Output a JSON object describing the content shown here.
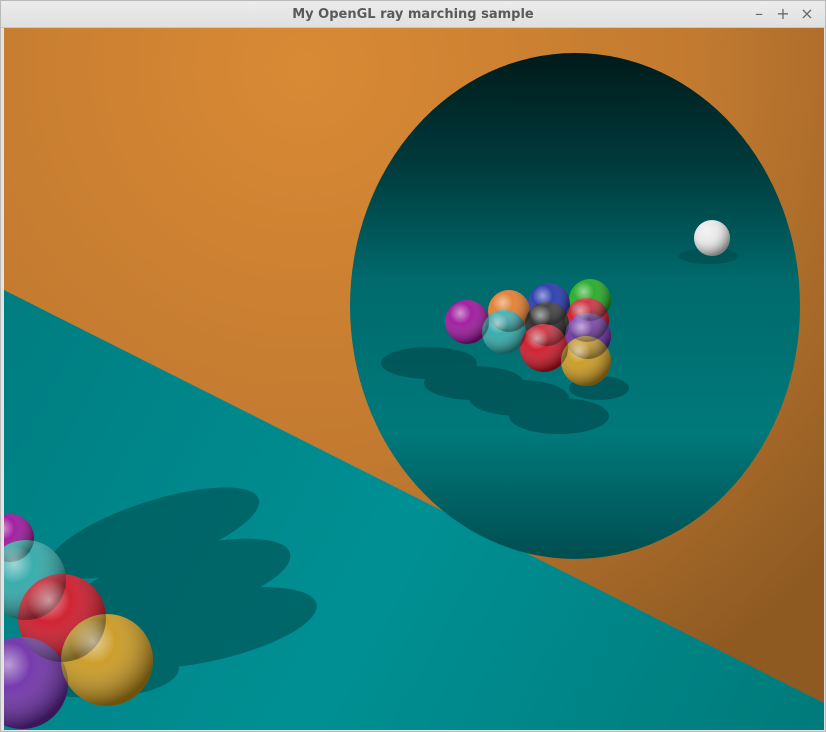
{
  "window": {
    "title": "My OpenGL ray marching sample",
    "controls": {
      "minimize": "–",
      "maximize": "+",
      "close": "×"
    }
  },
  "scene": {
    "wall_color": "#d2873a",
    "floor_color": "#008a8a",
    "ball_colors": [
      "#9a0f9a",
      "#e07a2a",
      "#2233aa",
      "#1ea81e",
      "#2aa6a6",
      "#222222",
      "#cc1122",
      "#6a2aa6",
      "#c8961a",
      "#e8e8e8"
    ]
  }
}
